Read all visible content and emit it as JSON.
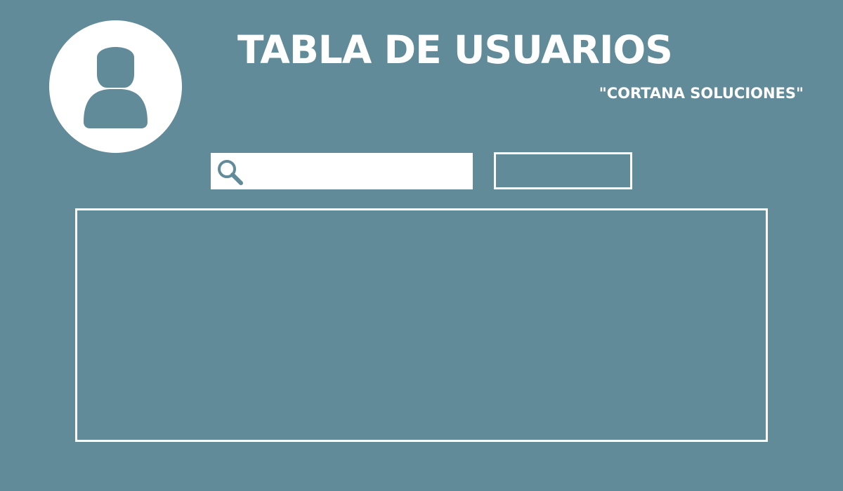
{
  "header": {
    "title": "TABLA DE USUARIOS",
    "subtitle": "\"CORTANA SOLUCIONES\""
  },
  "avatar": {
    "icon": "user-icon"
  },
  "search": {
    "icon": "search-icon",
    "value": "",
    "placeholder": "",
    "button_label": ""
  },
  "users_table": {
    "rows": []
  },
  "colors": {
    "background": "#628b99",
    "foreground": "#ffffff"
  }
}
